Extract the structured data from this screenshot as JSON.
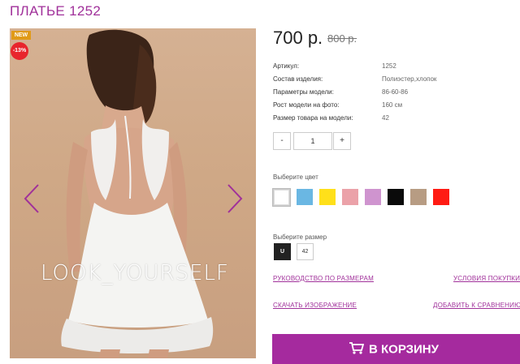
{
  "product": {
    "title": "ПЛАТЬЕ 1252",
    "price": "700 р.",
    "old_price": "800 р.",
    "badge_new": "NEW",
    "badge_discount": "-13%",
    "watermark": "LOOK_YOURSELF"
  },
  "specs": [
    {
      "label": "Артикул:",
      "value": "1252"
    },
    {
      "label": "Состав изделия:",
      "value": "Полиэстер,хлопок"
    },
    {
      "label": "Параметры модели:",
      "value": "86-60-86"
    },
    {
      "label": "Рост модели на фото:",
      "value": "160 см"
    },
    {
      "label": "Размер товара на модели:",
      "value": "42"
    }
  ],
  "quantity": {
    "minus": "-",
    "value": "1",
    "plus": "+"
  },
  "color": {
    "label": "Выберите цвет",
    "swatches": [
      "#ffffff",
      "#6ab7e3",
      "#ffe01a",
      "#eba2a9",
      "#cf94cf",
      "#0a0a0a",
      "#b79c83",
      "#ff1b13"
    ]
  },
  "size": {
    "label": "Выберите размер",
    "options": [
      "U",
      "42"
    ]
  },
  "links": {
    "size_guide": "РУКОВОДСТВО ПО РАЗМЕРАМ",
    "purchase_terms": "УСЛОВИЯ ПОКУПКИ",
    "download_image": "СКАЧАТЬ ИЗОБРАЖЕНИЕ",
    "add_compare": "ДОБАВИТЬ К СРАВНЕНИЮ"
  },
  "cart": {
    "label": "В КОРЗИНУ"
  },
  "colors": {
    "accent": "#a0309a",
    "button": "#a52a9e",
    "sale": "#e8252c",
    "new": "#e09a17"
  }
}
